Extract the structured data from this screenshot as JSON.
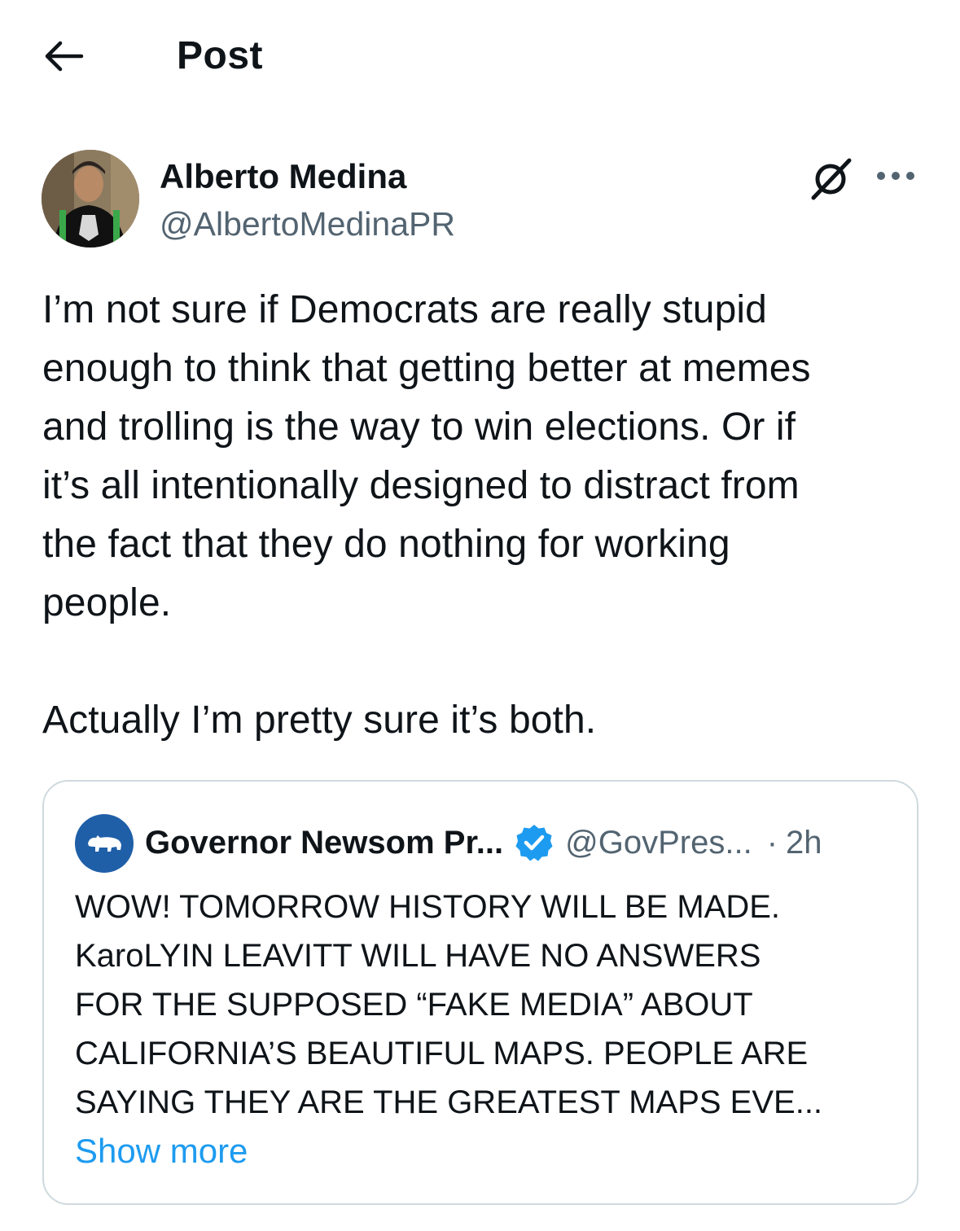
{
  "header": {
    "back_icon": "arrow-left-icon",
    "title": "Post"
  },
  "post": {
    "author": {
      "name": "Alberto Medina",
      "handle": "@AlbertoMedinaPR"
    },
    "grok_icon": "grok-icon",
    "more_icon": "more-horizontal-icon",
    "text_lines": [
      "I’m not sure if Democrats are really stupid",
      "enough to think that getting better at memes",
      "and trolling is the way to win elections. Or if",
      "it’s all intentionally designed to distract from",
      "the fact that they do nothing for working",
      "people.",
      "",
      "Actually I’m pretty sure it’s both."
    ]
  },
  "quote": {
    "name": "Governor Newsom Pr...",
    "verified_icon": "verified-badge-icon",
    "handle": "@GovPres...",
    "separator": "·",
    "time": "2h",
    "text_lines": [
      "WOW! TOMORROW HISTORY WILL BE MADE.",
      "KaroLYIN LEAVITT WILL HAVE NO ANSWERS",
      "FOR THE SUPPOSED “FAKE MEDIA” ABOUT",
      "CALIFORNIA’S BEAUTIFUL MAPS. PEOPLE ARE",
      "SAYING THEY ARE THE GREATEST MAPS EVE..."
    ],
    "show_more": "Show more"
  },
  "colors": {
    "text": "#0f1419",
    "secondary": "#536471",
    "link": "#1d9bf0",
    "border": "#cfd9de",
    "verified": "#1d9bf0",
    "quote_avatar": "#1f5fa8"
  }
}
